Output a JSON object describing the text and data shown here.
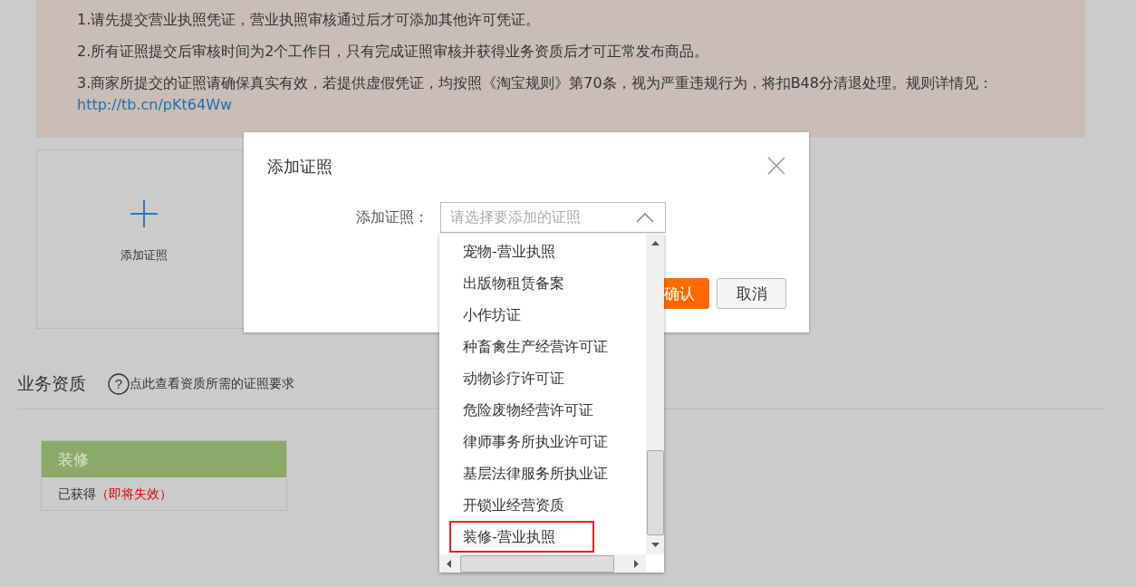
{
  "notice": {
    "lines": [
      "1.请先提交营业执照凭证，营业执照审核通过后才可添加其他许可凭证。",
      "2.所有证照提交后审核时间为2个工作日，只有完成证照审核并获得业务资质后才可正常发布商品。",
      "3.商家所提交的证照请确保真实有效，若提供虚假凭证，均按照《淘宝规则》第70条，视为严重违规行为，将扣B48分清退处理。规则详情见："
    ],
    "link": "http://tb.cn/pKt64Ww"
  },
  "add_card": {
    "label": "添加证照"
  },
  "qualification": {
    "title": "业务资质",
    "help_icon": "?",
    "help": "点此查看资质所需的证照要求",
    "cards": [
      {
        "name": "装修",
        "status": "已获得",
        "warning": "（即将失效）"
      }
    ]
  },
  "dialog": {
    "title": "添加证照",
    "field_label": "添加证照：",
    "select": {
      "placeholder": "请选择要添加的证照",
      "expanded": true
    },
    "options": [
      {
        "label": "宠物-营业执照",
        "highlighted": false
      },
      {
        "label": "出版物租赁备案",
        "highlighted": false
      },
      {
        "label": "小作坊证",
        "highlighted": false
      },
      {
        "label": "种畜禽生产经营许可证",
        "highlighted": false
      },
      {
        "label": "动物诊疗许可证",
        "highlighted": false
      },
      {
        "label": "危险废物经营许可证",
        "highlighted": false
      },
      {
        "label": "律师事务所执业许可证",
        "highlighted": false
      },
      {
        "label": "基层法律服务所执业证",
        "highlighted": false
      },
      {
        "label": "开锁业经营资质",
        "highlighted": false
      },
      {
        "label": "装修-营业执照",
        "highlighted": true
      }
    ],
    "buttons": [
      {
        "label": "确认",
        "kind": "primary"
      },
      {
        "label": "取消",
        "kind": "secondary"
      }
    ]
  }
}
